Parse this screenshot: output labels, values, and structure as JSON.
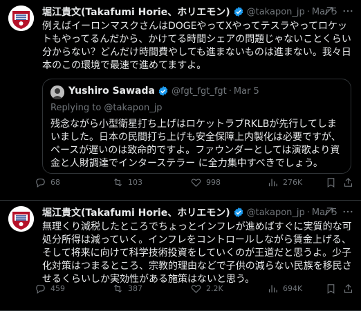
{
  "colors": {
    "background": "#000000",
    "text": "#e7e9ea",
    "muted": "#71767b",
    "verified": "#1d9bf0",
    "border": "#2f3336"
  },
  "tweets": [
    {
      "author": {
        "name": "堀江貴文(Takafumi Horie、ホリエモン)",
        "handle": "@takapon_jp",
        "verified_icon": "verified-badge-icon"
      },
      "separator": "·",
      "time": "Mar 5",
      "text": "例えばイーロンマスクさんはDOGEやってXやってテスラやってロケットもやってるんだから、かけてる時間シェアの問題じゃないことくらい分からない？どんだけ時間費やしても進まないものは進まない。我々日本のこの環境で最速で進めてますよ。",
      "quote": {
        "name": "Yushiro Sawada",
        "handle": "@fgt_fgt_fgt",
        "separator": "·",
        "time": "Mar 5",
        "reply_to": "Replying to @takapon_jp",
        "text": "残念ながら小型衛星打ち上げはロケットラブRKLBが先行してしまいました。日本の民間打ち上げも安全保障上内製化は必要ですが、ペースが遅いのは致命的ですよ。ファウンダーとしては演歌より資金と人財調達でインターステラー に全力集中すべきでしょう。"
      },
      "stats": {
        "replies": "68",
        "reposts": "103",
        "likes": "998",
        "views": "276K"
      }
    },
    {
      "author": {
        "name": "堀江貴文(Takafumi Horie、ホリエモン)",
        "handle": "@takapon_jp",
        "verified_icon": "verified-badge-icon"
      },
      "separator": "·",
      "time": "Mar 5",
      "text": "無理くり減税したところでちょっとインフレが進めばすぐに実質的な可処分所得は減っていく。インフレをコントロールしながら賃金上げる、そして将来に向けて科学技術投資をしていくのが王道だと思うよ。少子化対策はつまるところ、宗教的理由などで子供の減らない民族を移民させるくらいしか実効性がある施策はないと思う。",
      "stats": {
        "replies": "459",
        "reposts": "387",
        "likes": "2.2K",
        "views": "694K"
      }
    }
  ]
}
